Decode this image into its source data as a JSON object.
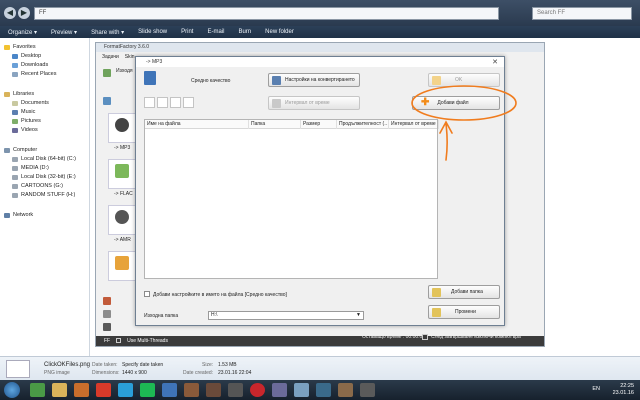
{
  "explorer": {
    "address": "FF",
    "search_placeholder": "Search FF",
    "menu": [
      "Organize ▾",
      "Preview ▾",
      "Share with ▾",
      "Slide show",
      "Print",
      "E-mail",
      "Burn",
      "New folder"
    ],
    "favorites_label": "Favorites",
    "favorites": [
      "Desktop",
      "Downloads",
      "Recent Places"
    ],
    "libraries_label": "Libraries",
    "libraries": [
      "Documents",
      "Music",
      "Pictures",
      "Videos"
    ],
    "computer_label": "Computer",
    "drives": [
      "Local Disk (64-bit) (C:)",
      "MEDIA (D:)",
      "Local Disk (32-bit) (E:)",
      "CARTOONS (G:)",
      "RANDOM STUFF (H:)"
    ],
    "network_label": "Network"
  },
  "formatfactory": {
    "title": "FormatFactory 3.6.0",
    "menu": [
      "Задачи",
      "Skin"
    ],
    "output_folder_label": "Изходя",
    "tiles": [
      "-> MP3",
      "-> FLAC",
      "-> AMR",
      ""
    ],
    "status": [
      "FF",
      "Use Multi-Threads"
    ]
  },
  "dialog": {
    "title": "-> MP3",
    "quality": "Средно качество",
    "settings_button": "Настройки на конвертирането",
    "ok_button": "OK",
    "time_interval_button": "Интервал от време",
    "add_file_button": "Добави файл",
    "columns": [
      "Име на файла",
      "Папка",
      "Размер",
      "Продължителност (…",
      "Интервал от време"
    ],
    "append_setting_label": "Добави настройките в името на файла [Средно качество]",
    "add_folder_button": "Добави папка",
    "output_folder_label": "Изходна папка",
    "output_folder_value": "H:\\",
    "options_button": "Промени",
    "remaining_time": "Оставащо време : 00:00:00",
    "shutdown_label": "След завършване изключи компютъра"
  },
  "details": {
    "filename": "ClickOKFiles.png",
    "filetype": "PNG image",
    "date_taken_label": "Date taken:",
    "date_taken_value": "Specify date taken",
    "dimensions_label": "Dimensions:",
    "dimensions_value": "1440 x 900",
    "size_label": "Size:",
    "size_value": "1.53 MB",
    "date_created_label": "Date created:",
    "date_created_value": "23.01.16 22:04"
  },
  "taskbar": {
    "language": "EN",
    "time": "22:25",
    "date": "23.01.16"
  },
  "colors": {
    "annotation": "#f07c1e",
    "add_icon": "#f28c1a",
    "explorer_chrome": "#2c4058"
  }
}
